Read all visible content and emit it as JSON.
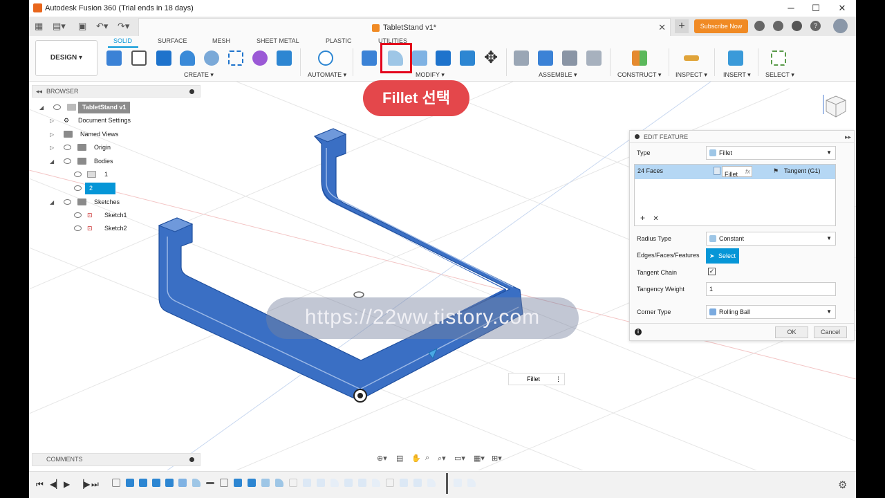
{
  "window": {
    "title": "Autodesk Fusion 360 (Trial ends in 18 days)",
    "minimize": "─",
    "maximize": "☐",
    "close": "✕"
  },
  "tabbar": {
    "doc_name": "TabletStand v1*",
    "close_tab": "✕",
    "new_tab": "+",
    "subscribe_label": "Subscribe Now"
  },
  "ribbon": {
    "workspace_label": "DESIGN ▾",
    "tabs": [
      "SOLID",
      "SURFACE",
      "MESH",
      "SHEET METAL",
      "PLASTIC",
      "UTILITIES"
    ],
    "groups": [
      "CREATE ▾",
      "AUTOMATE ▾",
      "MODIFY ▾",
      "ASSEMBLE ▾",
      "CONSTRUCT ▾",
      "INSPECT ▾",
      "INSERT ▾",
      "SELECT ▾"
    ]
  },
  "callout": {
    "text": "Fillet 선택"
  },
  "browser": {
    "header": "BROWSER",
    "root": "TabletStand v1",
    "items": {
      "document_settings": "Document Settings",
      "named_views": "Named Views",
      "origin": "Origin",
      "bodies": "Bodies",
      "body1": "1",
      "body2": "2",
      "sketches": "Sketches",
      "sketch1": "Sketch1",
      "sketch2": "Sketch2"
    }
  },
  "comments": {
    "label": "COMMENTS"
  },
  "edit_feature": {
    "header": "EDIT FEATURE",
    "type_label": "Type",
    "type_value": "Fillet",
    "faces_label": "24 Faces",
    "faces_fillet": "Fillet",
    "faces_fx": "fx",
    "faces_tangent": "Tangent (G1)",
    "add": "+",
    "remove": "✕",
    "radius_type_label": "Radius Type",
    "radius_type_value": "Constant",
    "edges_label": "Edges/Faces/Features",
    "select_btn": "Select",
    "tangent_chain_label": "Tangent Chain",
    "tangent_chain_checked": "✓",
    "tangency_weight_label": "Tangency Weight",
    "tangency_weight_value": "1",
    "corner_type_label": "Corner Type",
    "corner_type_value": "Rolling Ball",
    "ok": "OK",
    "cancel": "Cancel",
    "info": "i"
  },
  "fillet_tag": {
    "label": "Fillet",
    "more": "⋮"
  },
  "watermark": {
    "text": "https://22ww.tistory.com"
  },
  "colors": {
    "accent": "#0696d7",
    "body": "#3a6fc4",
    "highlight": "#e3001b",
    "callout": "#e4474b",
    "subscribe": "#f08a24"
  }
}
